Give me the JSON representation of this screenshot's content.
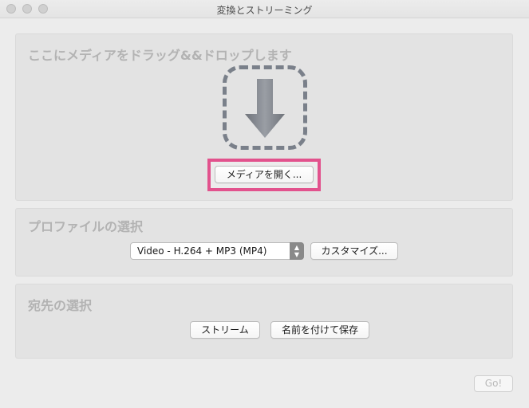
{
  "window": {
    "title": "変換とストリーミング"
  },
  "drop": {
    "heading": "ここにメディアをドラッグ&&ドロップします",
    "open_button": "メディアを開く..."
  },
  "profile": {
    "heading": "プロファイルの選択",
    "selected": "Video - H.264 + MP3 (MP4)",
    "customize_button": "カスタマイズ..."
  },
  "destination": {
    "heading": "宛先の選択",
    "stream_button": "ストリーム",
    "save_button": "名前を付けて保存"
  },
  "go_button": "Go!",
  "colors": {
    "highlight": "#e2528d",
    "drop_zone": "#7a808a"
  },
  "icons": {
    "drop_arrow": "down-arrow-icon",
    "select_arrows": "updown-chevron-icon"
  }
}
